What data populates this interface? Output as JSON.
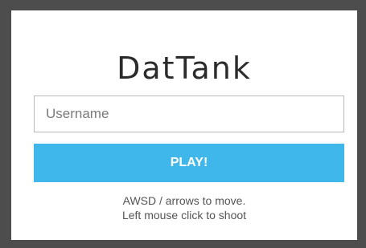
{
  "app": {
    "title": "DatTank"
  },
  "login": {
    "username_placeholder": "Username",
    "username_value": "",
    "play_label": "PLAY!"
  },
  "instructions": {
    "line1": "AWSD / arrows to move.",
    "line2": "Left mouse click to shoot"
  },
  "colors": {
    "background": "#4d4d4d",
    "panel": "#ffffff",
    "accent": "#3fb7ea"
  }
}
